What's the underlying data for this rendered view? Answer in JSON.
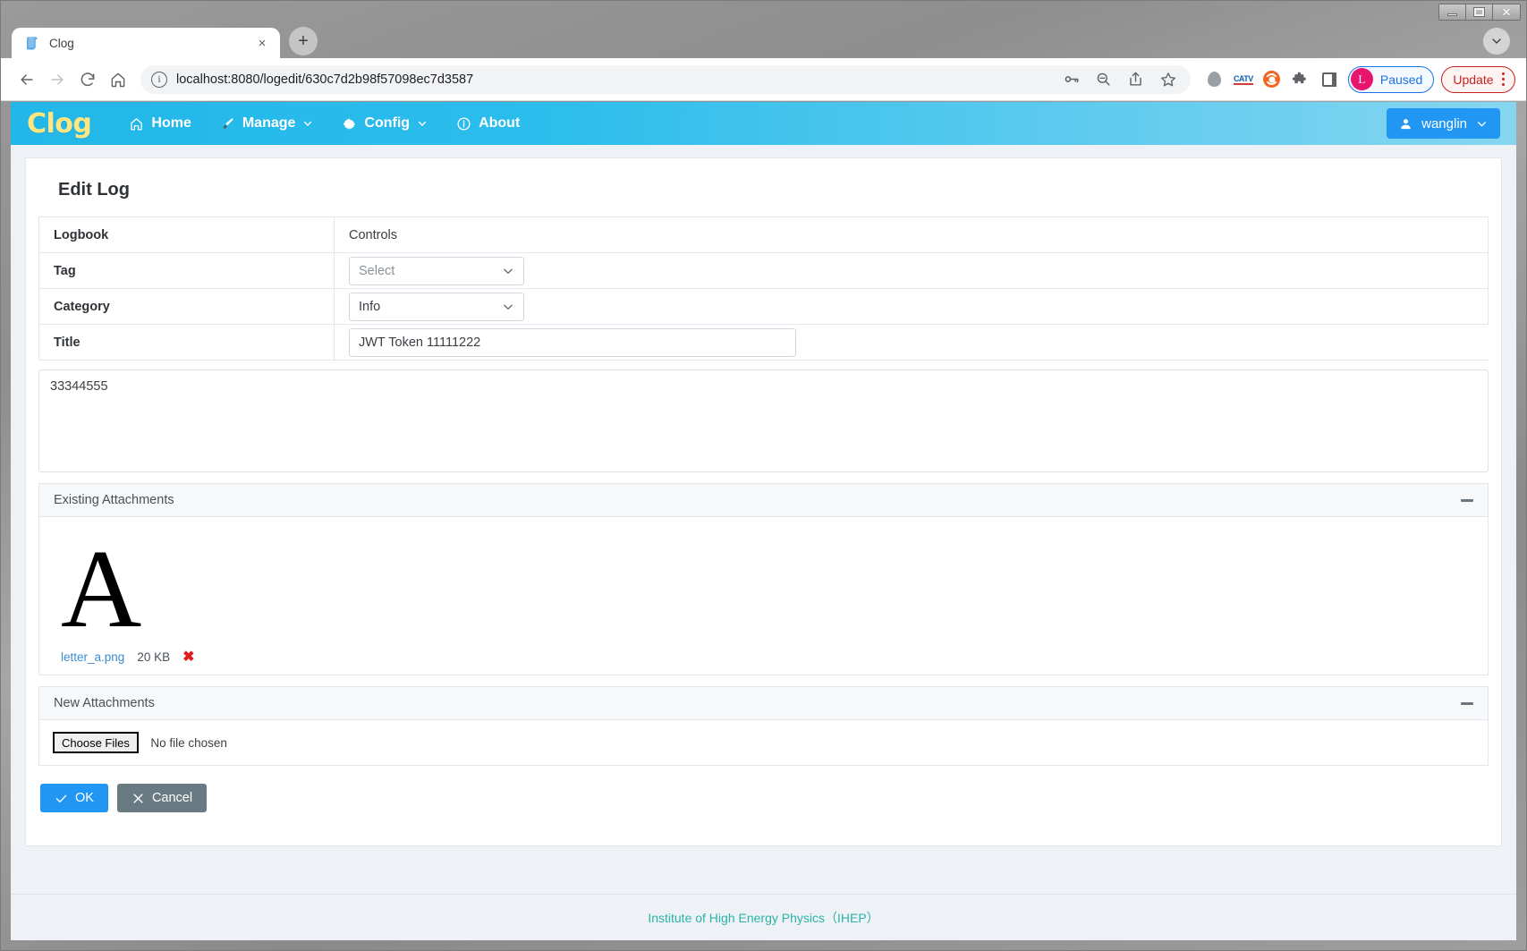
{
  "browser": {
    "tab": {
      "title": "Clog",
      "favicon": "book-icon",
      "close_label": "×"
    },
    "new_tab_label": "+",
    "url": "localhost:8080/logedit/630c7d2b98f57098ec7d3587",
    "nav": {
      "back": "←",
      "forward": "→",
      "reload": "↻",
      "home": "⌂"
    },
    "omnibox_actions": [
      "key-icon",
      "zoom-out-icon",
      "share-icon",
      "bookmark-star-icon"
    ],
    "extensions": [
      "balloon-icon",
      "catv-icon",
      "orange-circle-icon",
      "puzzle-piece-icon",
      "side-panel-icon"
    ],
    "catv_label": "CATV",
    "profile": {
      "initial": "L",
      "label": "Paused"
    },
    "update": {
      "label": "Update"
    },
    "window_controls": {
      "minimize": "—",
      "maximize": "□",
      "close": "✕"
    }
  },
  "app": {
    "brand": "Clog",
    "nav_items": [
      {
        "label": "Home",
        "icon": "home-icon",
        "caret": ""
      },
      {
        "label": "Manage",
        "icon": "brush-icon",
        "caret": "⌄"
      },
      {
        "label": "Config",
        "icon": "gear-icon",
        "caret": "⌄"
      },
      {
        "label": "About",
        "icon": "info-circle-icon",
        "caret": ""
      }
    ],
    "user": {
      "label": "wanglin",
      "icon": "user-icon",
      "caret": "⌄"
    }
  },
  "page": {
    "title": "Edit Log",
    "fields": {
      "logbook": {
        "label": "Logbook",
        "value": "Controls"
      },
      "tag": {
        "label": "Tag",
        "value": "",
        "placeholder": "Select"
      },
      "category": {
        "label": "Category",
        "value": "Info"
      },
      "title": {
        "label": "Title",
        "value": "JWT Token 11111222"
      }
    },
    "body_text": "33344555",
    "existing_attachments": {
      "header": "Existing Attachments",
      "collapse_icon": "minus-icon",
      "items": [
        {
          "thumbnail_letter": "A",
          "filename": "letter_a.png",
          "size": "20 KB",
          "delete_icon": "red-x-icon"
        }
      ]
    },
    "new_attachments": {
      "header": "New Attachments",
      "collapse_icon": "minus-icon",
      "choose_button": "Choose Files",
      "no_file_text": "No file chosen"
    },
    "buttons": {
      "ok": "OK",
      "cancel": "Cancel"
    }
  },
  "footer": {
    "text": "Institute of High Energy Physics（IHEP）"
  },
  "colors": {
    "navbar": "#22b7e8",
    "brand": "#ffe680",
    "primary": "#2196f3",
    "cancel": "#6a7a82",
    "footer_text": "#2bb3a8",
    "link": "#3b8cd1",
    "delete": "#e11d1d"
  }
}
